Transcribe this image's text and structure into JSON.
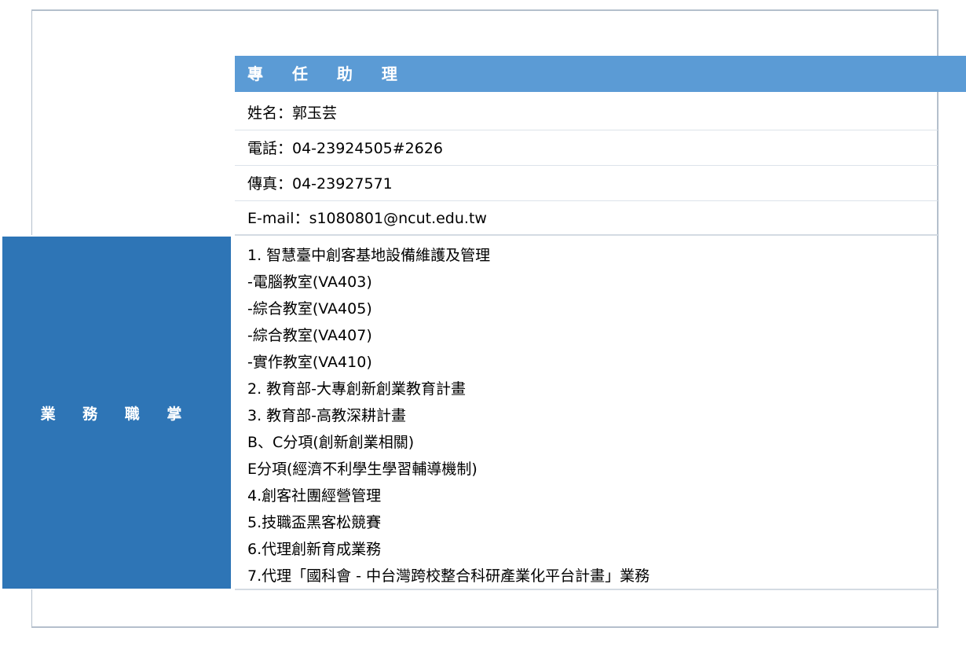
{
  "header": {
    "title": "專 任 助 理"
  },
  "contact": {
    "name": "姓名：郭玉芸",
    "phone": "電話：04-23924505#2626",
    "fax": "傳真：04-23927571",
    "email": "E-mail：s1080801@ncut.edu.tw"
  },
  "duties_section": {
    "label": "業 務 職 掌",
    "items": [
      "1. 智慧臺中創客基地設備維護及管理",
      "-電腦教室(VA403)",
      "-綜合教室(VA405)",
      "-綜合教室(VA407)",
      "-實作教室(VA410)",
      "2. 教育部-大專創新創業教育計畫",
      "3. 教育部-高教深耕計畫",
      "B、C分項(創新創業相關)",
      "E分項(經濟不利學生學習輔導機制)",
      "4.創客社團經營管理",
      "5.技職盃黑客松競賽",
      "6.代理創新育成業務",
      "7.代理「國科會 - 中台灣跨校整合科研產業化平台計畫」業務"
    ]
  },
  "colors": {
    "header_bg": "#5b9bd5",
    "label_bg": "#2e75b6",
    "frame": "#b4bfcc"
  }
}
